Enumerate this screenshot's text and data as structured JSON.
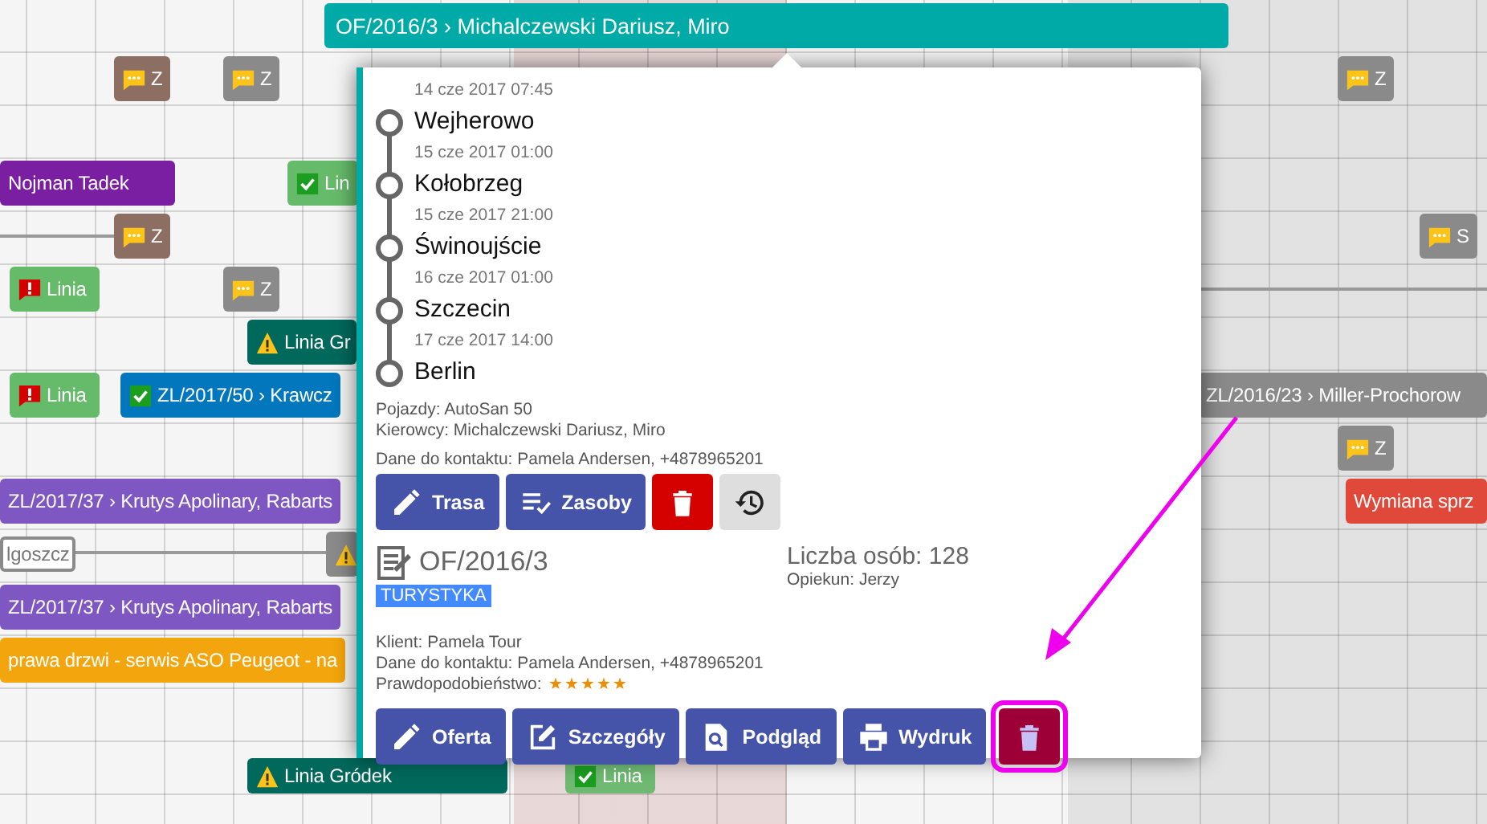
{
  "schedule": {
    "bar": {
      "label": "OF/2016/3 › Michalczewski Dariusz, Miro",
      "color": "#00aaa7"
    },
    "chips": [
      {
        "kind": "comment",
        "label": "Z",
        "color": "#8d6e63"
      },
      {
        "kind": "comment",
        "label": "Z",
        "color": "#8a8a8a"
      },
      {
        "kind": "comment",
        "label": "Z",
        "color": "#8a8a8a"
      },
      {
        "kind": "plain",
        "label": "Nojman Tadek",
        "color": "#7b1fa2"
      },
      {
        "kind": "check",
        "label": "Lin",
        "color": "#66bb6a"
      },
      {
        "kind": "comment",
        "label": "Z",
        "color": "#8d6e63"
      },
      {
        "kind": "comment",
        "label": "S",
        "color": "#8a8a8a"
      },
      {
        "kind": "alert",
        "label": "Linia",
        "color": "#66bb6a"
      },
      {
        "kind": "comment",
        "label": "Z",
        "color": "#8a8a8a"
      },
      {
        "kind": "warning",
        "label": "Linia Gr",
        "color": "#00695c"
      },
      {
        "kind": "alert",
        "label": "Linia",
        "color": "#66bb6a"
      },
      {
        "kind": "check",
        "label": "ZL/2017/50 › Krawcz",
        "color": "#0277bd"
      },
      {
        "kind": "plain",
        "label": "ZL/2016/23 › Miller-Prochorow",
        "color": "#8a8a8a"
      },
      {
        "kind": "comment",
        "label": "Z",
        "color": "#8a8a8a"
      },
      {
        "kind": "plain",
        "label": "ZL/2017/37 › Krutys Apolinary, Rabarts",
        "color": "#7e57c2"
      },
      {
        "kind": "plain",
        "label": "Wymiana sprz",
        "color": "#e0483a"
      },
      {
        "kind": "outline",
        "label": "lgoszcz",
        "color": "#8a8a8a"
      },
      {
        "kind": "warning",
        "color": "#8a8a8a"
      },
      {
        "kind": "plain",
        "label": "ZL/2017/37 › Krutys Apolinary, Rabarts",
        "color": "#7e57c2"
      },
      {
        "kind": "plain",
        "label": "prawa drzwi -  serwis ASO Peugeot - na",
        "color": "#f2a50c"
      },
      {
        "kind": "warning",
        "label": "Linia Gródek",
        "color": "#00695c"
      },
      {
        "kind": "check",
        "label": "Linia",
        "color": "#6fb972"
      }
    ]
  },
  "popup": {
    "stops": [
      {
        "time": "14 cze 2017 07:45",
        "place": "Wejherowo"
      },
      {
        "time": "15 cze 2017 01:00",
        "place": "Kołobrzeg"
      },
      {
        "time": "15 cze 2017 21:00",
        "place": "Świnoujście"
      },
      {
        "time": "16 cze 2017 01:00",
        "place": "Szczecin"
      },
      {
        "time": "17 cze 2017 14:00",
        "place": "Berlin"
      }
    ],
    "vehicles": "Pojazdy: AutoSan 50",
    "drivers": "Kierowcy: Michalczewski Dariusz, Miro",
    "contact": "Dane do kontaktu: Pamela Andersen, +4878965201",
    "route_actions": [
      {
        "kind": "edit",
        "label": "Trasa"
      },
      {
        "kind": "resources",
        "label": "Zasoby"
      },
      {
        "kind": "delete"
      },
      {
        "kind": "history"
      }
    ],
    "offer": {
      "number": "OF/2016/3",
      "tag": "TURYSTYKA",
      "people": "Liczba osób: 128",
      "guardian": "Opiekun: Jerzy",
      "client": "Klient: Pamela Tour",
      "contact": "Dane do kontaktu: Pamela Andersen, +4878965201",
      "probability_label": "Prawdopodobieństwo:",
      "stars": 5
    },
    "offer_actions": [
      {
        "kind": "edit",
        "label": "Oferta"
      },
      {
        "kind": "details",
        "label": "Szczegóły"
      },
      {
        "kind": "preview",
        "label": "Podgląd"
      },
      {
        "kind": "print",
        "label": "Wydruk"
      },
      {
        "kind": "delete_dark",
        "highlighted": true
      }
    ]
  }
}
